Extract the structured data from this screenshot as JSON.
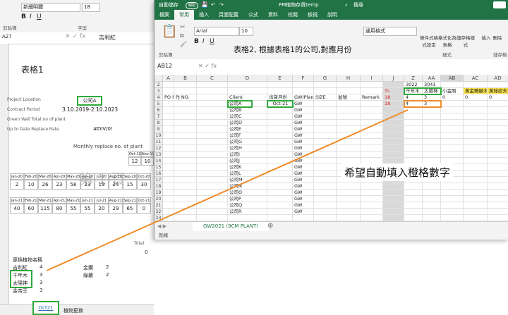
{
  "left_window": {
    "font_name": "新細明體",
    "font_size": "18",
    "clipboard_label": "剪貼簿",
    "font_label": "字型",
    "name_box": "A27",
    "formula_value": "吉利紅",
    "sheet_title": "表格1",
    "project_location_label": "Project Location",
    "project_location_value": "公司A",
    "contract_period_label": "Contract Period",
    "contract_period_value": "3.10.2019-2.10.2023",
    "green_wall_label": "Green Wall Total no of plant",
    "replace_rate_label": "Up to Date Replace Rate",
    "replace_rate_value": "#DIV/0!",
    "monthly_label": "Monthly replace no. of plant",
    "row1_headers": [
      "Oct-19",
      "Nov-19"
    ],
    "row1_values": [
      "12",
      "10"
    ],
    "row2_headers": [
      "Jan-20",
      "Feb-20",
      "Mar-20",
      "Apr-20",
      "May-20",
      "Jun-20",
      "Jul-20",
      "Aug-20",
      "Sep-20",
      "Oct-20"
    ],
    "row2_values": [
      "2",
      "10",
      "26",
      "23",
      "58",
      "23",
      "19",
      "24",
      "15",
      "30"
    ],
    "row3_headers": [
      "Jan-21",
      "Feb-21",
      "Mar-21",
      "Apr-21",
      "May-21",
      "Jun-21",
      "Jul-21",
      "Aug-21",
      "Sep-21",
      "Oct-21"
    ],
    "row3_values": [
      "40",
      "60",
      "115",
      "80",
      "55",
      "55",
      "20",
      "29",
      "65",
      "0"
    ],
    "watermark": "第 1 頁",
    "total_label": "Total",
    "total_value": "0",
    "plant_list_title": "更換植物名稱",
    "plants": [
      {
        "name": "吉利紅",
        "qty": "4"
      },
      {
        "name": "千年木",
        "qty": "3"
      },
      {
        "name": "太陽神",
        "qty": "3"
      },
      {
        "name": "金帝王",
        "qty": "3"
      }
    ],
    "plants2": [
      {
        "name": "金鑽",
        "qty": "2"
      },
      {
        "name": "綠蘿",
        "qty": "2"
      }
    ],
    "tabs": [
      "Oct21",
      "植物更換"
    ]
  },
  "right_window": {
    "autosave_label": "自動儲存",
    "autosave_state": "關閉",
    "file_title": "PM植物存貨temp",
    "search_label": "搜尋",
    "menu": [
      "檔案",
      "常用",
      "插入",
      "頁面配置",
      "公式",
      "資料",
      "校閱",
      "檢視",
      "說明"
    ],
    "active_menu": "常用",
    "font_name": "Arial",
    "font_size": "10",
    "number_format": "通用格式",
    "clipboard_label": "剪貼簿",
    "style_label": "樣式",
    "cells_label": "儲存格",
    "conditional_format": "條件式格式設定",
    "format_as_table": "格式化為表格",
    "cell_styles": "儲存格樣式",
    "insert_btn": "插入",
    "delete_btn": "刪除",
    "format_btn": "格式",
    "annotation": "表格2, 根據表格1的公司,對應月份",
    "name_box": "AB12",
    "columns": [
      "A",
      "B",
      "C",
      "D",
      "E",
      "F",
      "G",
      "H",
      "I",
      "J",
      "Z",
      "AA",
      "AB",
      "AC",
      "AD"
    ],
    "header_row3": {
      "code1": "3022",
      "code2": "3041"
    },
    "row3": {
      "TL": "TL",
      "name1": "千年木",
      "name2": "太陽神",
      "c3": "小金剛",
      "c4": "黃金鴨腳木",
      "c5": "黃綠紋夫"
    },
    "row4_headers": [
      "PO NO.",
      "PJ NO.",
      "Client",
      "出貨月份",
      "GW/Planter",
      "SIZE",
      "盆號",
      "Remark"
    ],
    "row5": {
      "client": "公司A",
      "month": "Oct-21",
      "planter": "GW",
      "tl": "18",
      "z": "4",
      "aa": "3"
    },
    "clients": [
      "公司B",
      "公司C",
      "公司D",
      "公司E",
      "公司F",
      "公司G",
      "公司H",
      "公司I",
      "公司J",
      "公司K",
      "公司L",
      "公司M",
      "公司N",
      "公司O",
      "公司P",
      "公司Q",
      "公司R"
    ],
    "row4_values": {
      "tl": "18",
      "z": "4",
      "aa": "3",
      "ab": "0",
      "ac": "0",
      "ad": "0"
    },
    "row_numbers": [
      "2",
      "3",
      "4",
      "5",
      "6",
      "7",
      "8",
      "9",
      "10",
      "11",
      "12",
      "13",
      "14",
      "15",
      "16",
      "17",
      "18",
      "19",
      "20",
      "21",
      "22",
      "23"
    ],
    "big_note": "希望自動填入橙格數字",
    "sheet_tab": "GW2021 (9CM PLANT)",
    "status_text": "就緒"
  },
  "colors": {
    "excel_green": "#217346",
    "highlight_green": "#2eaa3a",
    "highlight_orange": "#f08c2a",
    "red_text": "#e02020"
  }
}
